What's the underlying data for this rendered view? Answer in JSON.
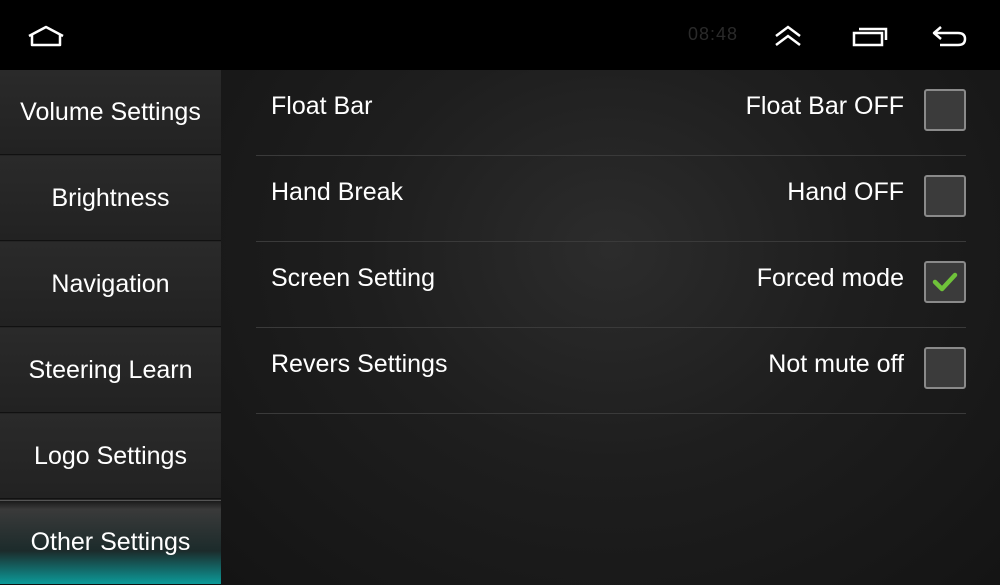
{
  "system_bar": {
    "home_icon": "home-icon",
    "clock": "08:48",
    "collapse_icon": "chevron-double-up-icon",
    "recents_icon": "recent-apps-icon",
    "back_icon": "back-arrow-icon"
  },
  "sidebar": {
    "items": [
      {
        "label": "Volume Settings",
        "active": false
      },
      {
        "label": "Brightness",
        "active": false
      },
      {
        "label": "Navigation",
        "active": false
      },
      {
        "label": "Steering Learn",
        "active": false
      },
      {
        "label": "Logo Settings",
        "active": false
      },
      {
        "label": "Other Settings",
        "active": true
      }
    ]
  },
  "settings": {
    "rows": [
      {
        "label": "Float Bar",
        "state": "Float Bar OFF",
        "checked": false
      },
      {
        "label": "Hand Break",
        "state": "Hand OFF",
        "checked": false
      },
      {
        "label": "Screen Setting",
        "state": "Forced mode",
        "checked": true
      },
      {
        "label": "Revers Settings",
        "state": "Not mute off",
        "checked": false
      }
    ]
  },
  "colors": {
    "accent_teal": "#0c9a99",
    "check_green": "#6fc23a"
  }
}
